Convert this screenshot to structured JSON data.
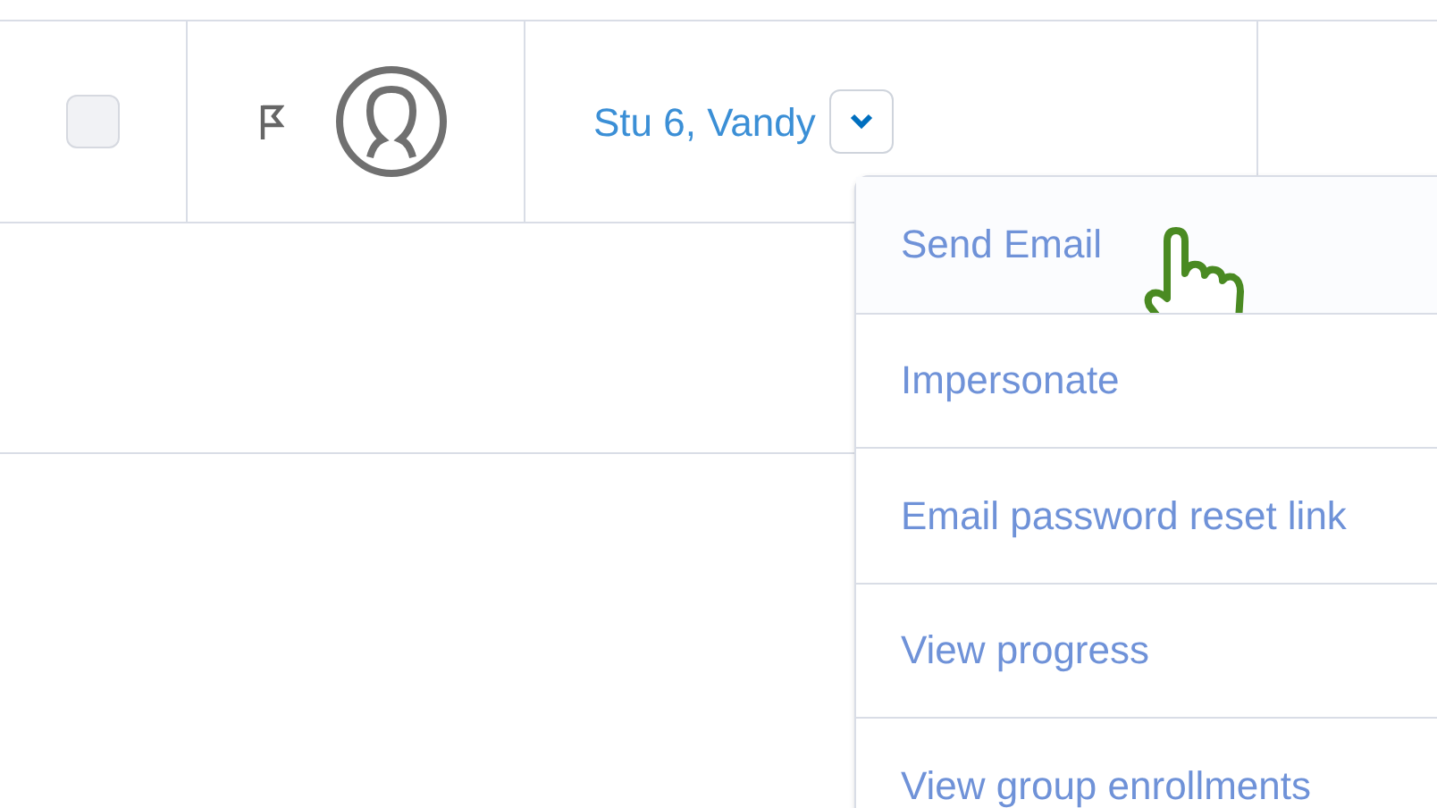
{
  "row": {
    "checked": false,
    "name": "Stu 6, Vandy"
  },
  "menu": {
    "expanded": true,
    "items": [
      {
        "label": "Send Email",
        "hovered": true
      },
      {
        "label": "Impersonate",
        "hovered": false
      },
      {
        "label": "Email password reset link",
        "hovered": false
      },
      {
        "label": "View progress",
        "hovered": false
      },
      {
        "label": "View group enrollments",
        "hovered": false
      }
    ]
  }
}
